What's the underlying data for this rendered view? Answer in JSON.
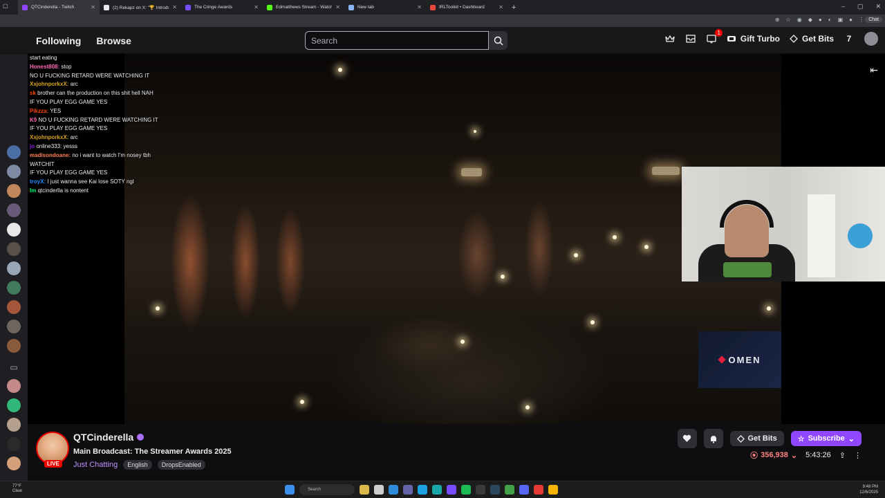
{
  "browser": {
    "tabs": [
      {
        "title": "QTCinderella - Twitch",
        "favicon_color": "#9147ff"
      },
      {
        "title": "(2) Rekapz on X: \"🏆 Introducing",
        "favicon_color": "#e7e9ea"
      },
      {
        "title": "The Cringe Awards",
        "favicon_color": "#7b4bff"
      },
      {
        "title": "Edmatthews Stream - Watch Live",
        "favicon_color": "#53fc18"
      },
      {
        "title": "New tab",
        "favicon_color": "#8ab4f8"
      },
      {
        "title": "IRLToolkit • Dashboard",
        "favicon_color": "#e8453c"
      }
    ],
    "new_tab_label": "+",
    "chat_pill": "Chat"
  },
  "nav": {
    "following": "Following",
    "browse": "Browse",
    "search_placeholder": "Search",
    "gift_turbo": "Gift Turbo",
    "get_bits": "Get Bits",
    "notification_count": "1"
  },
  "chat": [
    {
      "user": "",
      "text": "start eating",
      "color": "#ffffff"
    },
    {
      "user": "Honest808:",
      "text": "stop",
      "color": "#ff69b4"
    },
    {
      "user": "",
      "text": "NO U FUCKING RETARD WERE WATCHING IT",
      "color": "#ffffff"
    },
    {
      "user": "XxjohnporkxX:",
      "text": "arc",
      "color": "#daa520"
    },
    {
      "user": "sk",
      "text": "brother can the production on this shit hell NAH",
      "color": "#ff4500"
    },
    {
      "user": "",
      "text": "IF YOU PLAY EGG GAME YES",
      "color": "#ffffff"
    },
    {
      "user": "Pikzza:",
      "text": "YES",
      "color": "#ff4500"
    },
    {
      "user": "K9",
      "text": "NO U FUCKING RETARD WERE WATCHING IT",
      "color": "#ff69b4"
    },
    {
      "user": "",
      "text": "IF YOU PLAY EGG GAME YES",
      "color": "#ffffff"
    },
    {
      "user": "XxjohnporkxX:",
      "text": "arc",
      "color": "#daa520"
    },
    {
      "user": "jo",
      "text": "online333:  yesss",
      "color": "#8a2be2"
    },
    {
      "user": "madisondoane:",
      "text": "no i want to watch I'm nosey tbh",
      "color": "#ff7f50"
    },
    {
      "user": "",
      "text": "WATCHIT",
      "color": "#ffffff"
    },
    {
      "user": "",
      "text": "IF YOU PLAY EGG GAME YES",
      "color": "#ffffff"
    },
    {
      "user": "troyX:",
      "text": "I just wanna see Kai lose SOTY ngl",
      "color": "#1e90ff"
    },
    {
      "user": "Im",
      "text": "qtcinderlla is nontent",
      "color": "#00ff7f"
    }
  ],
  "overlay": {
    "sponsor": "OMEN"
  },
  "channel": {
    "name": "QTCinderella",
    "live": "LIVE",
    "title": "Main Broadcast: The Streamer Awards 2025",
    "category": "Just Chatting",
    "tags": [
      "English",
      "DropsEnabled"
    ],
    "get_bits": "Get Bits",
    "subscribe": "Subscribe",
    "viewers": "356,938",
    "uptime": "5:43:26"
  },
  "taskbar": {
    "weather_temp": "77°F",
    "weather_desc": "Clear",
    "search": "Search",
    "time": "9:48 PM",
    "date": "12/6/2025"
  },
  "colors": {
    "twitch_purple": "#9147ff",
    "live_red": "#eb0400",
    "viewer_red": "#ff8280"
  }
}
